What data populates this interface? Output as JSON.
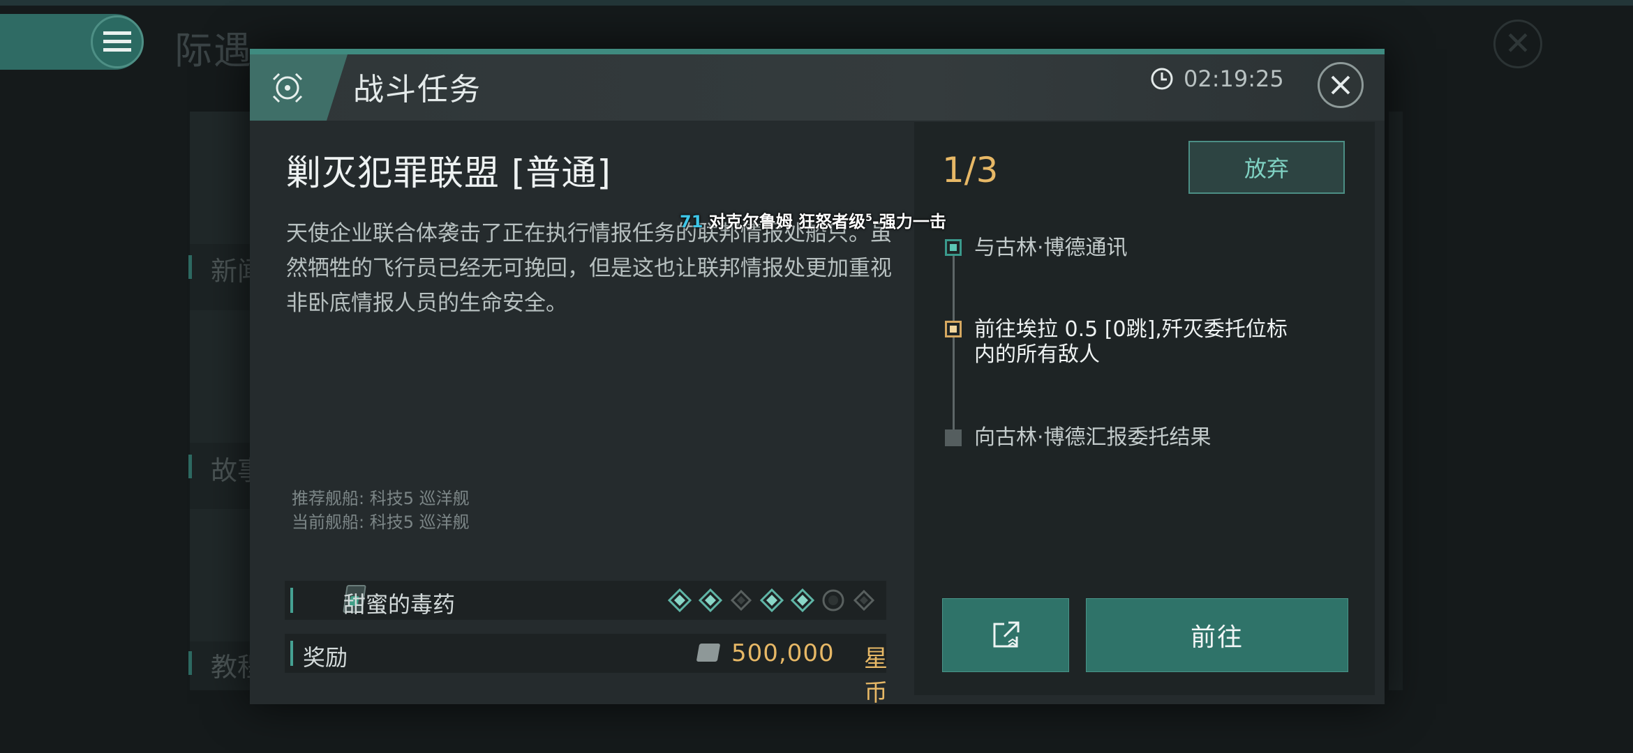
{
  "background": {
    "title": "际遇",
    "side_labels": [
      "新闻",
      "故事",
      "教程"
    ]
  },
  "dialog": {
    "header_title": "战斗任务",
    "timer": "02:19:25",
    "mission_title": "剿灭犯罪联盟 [普通]",
    "description": "天使企业联合体袭击了正在执行情报任务的联邦情报处船只。虽然牺牲的飞行员已经无可挽回，但是这也让联邦情报处更加重视非卧底情报人员的生命安全。",
    "recommended_ship": "推荐舰船: 科技5 巡洋舰",
    "current_ship": "当前舰船: 科技5 巡洋舰",
    "item": {
      "name": "甜蜜的毒药",
      "slots": [
        "filled",
        "filled",
        "empty",
        "filled",
        "filled",
        "circle",
        "empty"
      ]
    },
    "reward": {
      "label": "奖励",
      "amount": "500,000",
      "unit": "星币"
    }
  },
  "objectives": {
    "progress": "1/3",
    "abandon_label": "放弃",
    "steps": [
      {
        "text": "与古林·博德通讯",
        "state": "done"
      },
      {
        "text": "前往埃拉 0.5 [0跳],歼灭委托位标内的所有敌人",
        "state": "active"
      },
      {
        "text": "向古林·博德汇报委托结果",
        "state": "pending"
      }
    ],
    "go_label": "前往"
  },
  "notice": {
    "level": "71",
    "text": "对克尔鲁姆 狂怒者级",
    "superscript": "5",
    "suffix": "-强力一击"
  },
  "colors": {
    "accent_teal": "#3f8b80",
    "gold": "#e7b866",
    "panel": "#252b2d"
  }
}
